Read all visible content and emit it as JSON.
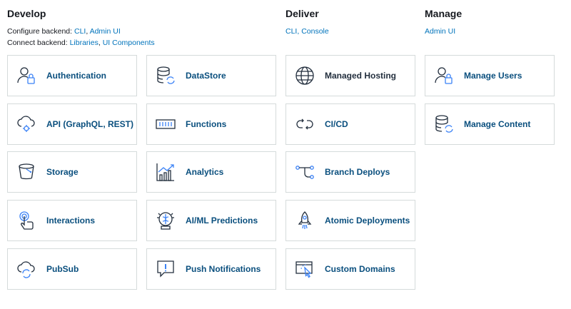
{
  "colors": {
    "link": "#0073bb",
    "card_label": "#0a4f7e",
    "icon_accent": "#3b82f6",
    "border": "#d5dbdb"
  },
  "develop": {
    "title": "Develop",
    "configure_prefix": "Configure backend: ",
    "configure_links": [
      "CLI",
      "Admin UI"
    ],
    "connect_prefix": "Connect backend: ",
    "connect_links": [
      "Libraries",
      "UI Components"
    ],
    "cards": [
      {
        "label": "Authentication",
        "icon": "user-lock-icon"
      },
      {
        "label": "DataStore",
        "icon": "database-sync-icon"
      },
      {
        "label": "API (GraphQL, REST)",
        "icon": "cloud-gear-icon"
      },
      {
        "label": "Functions",
        "icon": "function-icon"
      },
      {
        "label": "Storage",
        "icon": "bucket-icon"
      },
      {
        "label": "Analytics",
        "icon": "analytics-icon"
      },
      {
        "label": "Interactions",
        "icon": "touch-icon"
      },
      {
        "label": "AI/ML Predictions",
        "icon": "brain-icon"
      },
      {
        "label": "PubSub",
        "icon": "cloud-sync-icon"
      },
      {
        "label": "Push Notifications",
        "icon": "notification-icon"
      }
    ]
  },
  "deliver": {
    "title": "Deliver",
    "links": [
      "CLI",
      "Console"
    ],
    "cards": [
      {
        "label": "Managed Hosting",
        "icon": "globe-icon"
      },
      {
        "label": "CI/CD",
        "icon": "cicd-icon"
      },
      {
        "label": "Branch Deploys",
        "icon": "branch-icon"
      },
      {
        "label": "Atomic Deployments",
        "icon": "rocket-icon"
      },
      {
        "label": "Custom Domains",
        "icon": "domain-cursor-icon"
      }
    ]
  },
  "manage": {
    "title": "Manage",
    "links": [
      "Admin UI"
    ],
    "cards": [
      {
        "label": "Manage Users",
        "icon": "user-lock-icon"
      },
      {
        "label": "Manage Content",
        "icon": "database-sync-icon"
      }
    ]
  }
}
